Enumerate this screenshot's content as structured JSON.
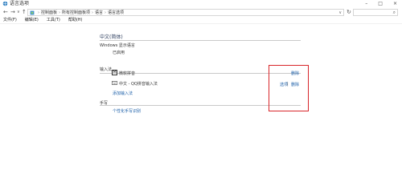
{
  "window": {
    "title": "语言选项",
    "minimize": "–",
    "maximize": "□",
    "close": "×"
  },
  "nav": {
    "back": "←",
    "forward": "→",
    "recent": "∨",
    "up": "↑",
    "breadcrumbs": [
      "控制面板",
      "所有控制面板项",
      "语言",
      "语言选项"
    ],
    "refresh": "↻",
    "search_placeholder": "",
    "dropdown": "∨"
  },
  "menu": [
    "文件(F)",
    "编辑(E)",
    "工具(T)",
    "帮助(H)"
  ],
  "content": {
    "language_title": "中文(简体)",
    "windows_display_label": "Windows 显示语言",
    "windows_display_value": "已启用",
    "input_method_label": "输入法",
    "ime1": {
      "icon": "M",
      "name": "微软拼音",
      "delete": "删除"
    },
    "ime2": {
      "name": "中文 - QQ拼音输入法",
      "options": "选项",
      "separator": "|",
      "delete": "删除"
    },
    "add_ime": "添加输入法",
    "handwriting_label": "手写",
    "personalize_handwriting": "个性化手写识别"
  },
  "colors": {
    "link": "#1a5ea8",
    "highlight_box": "#d8262b"
  }
}
